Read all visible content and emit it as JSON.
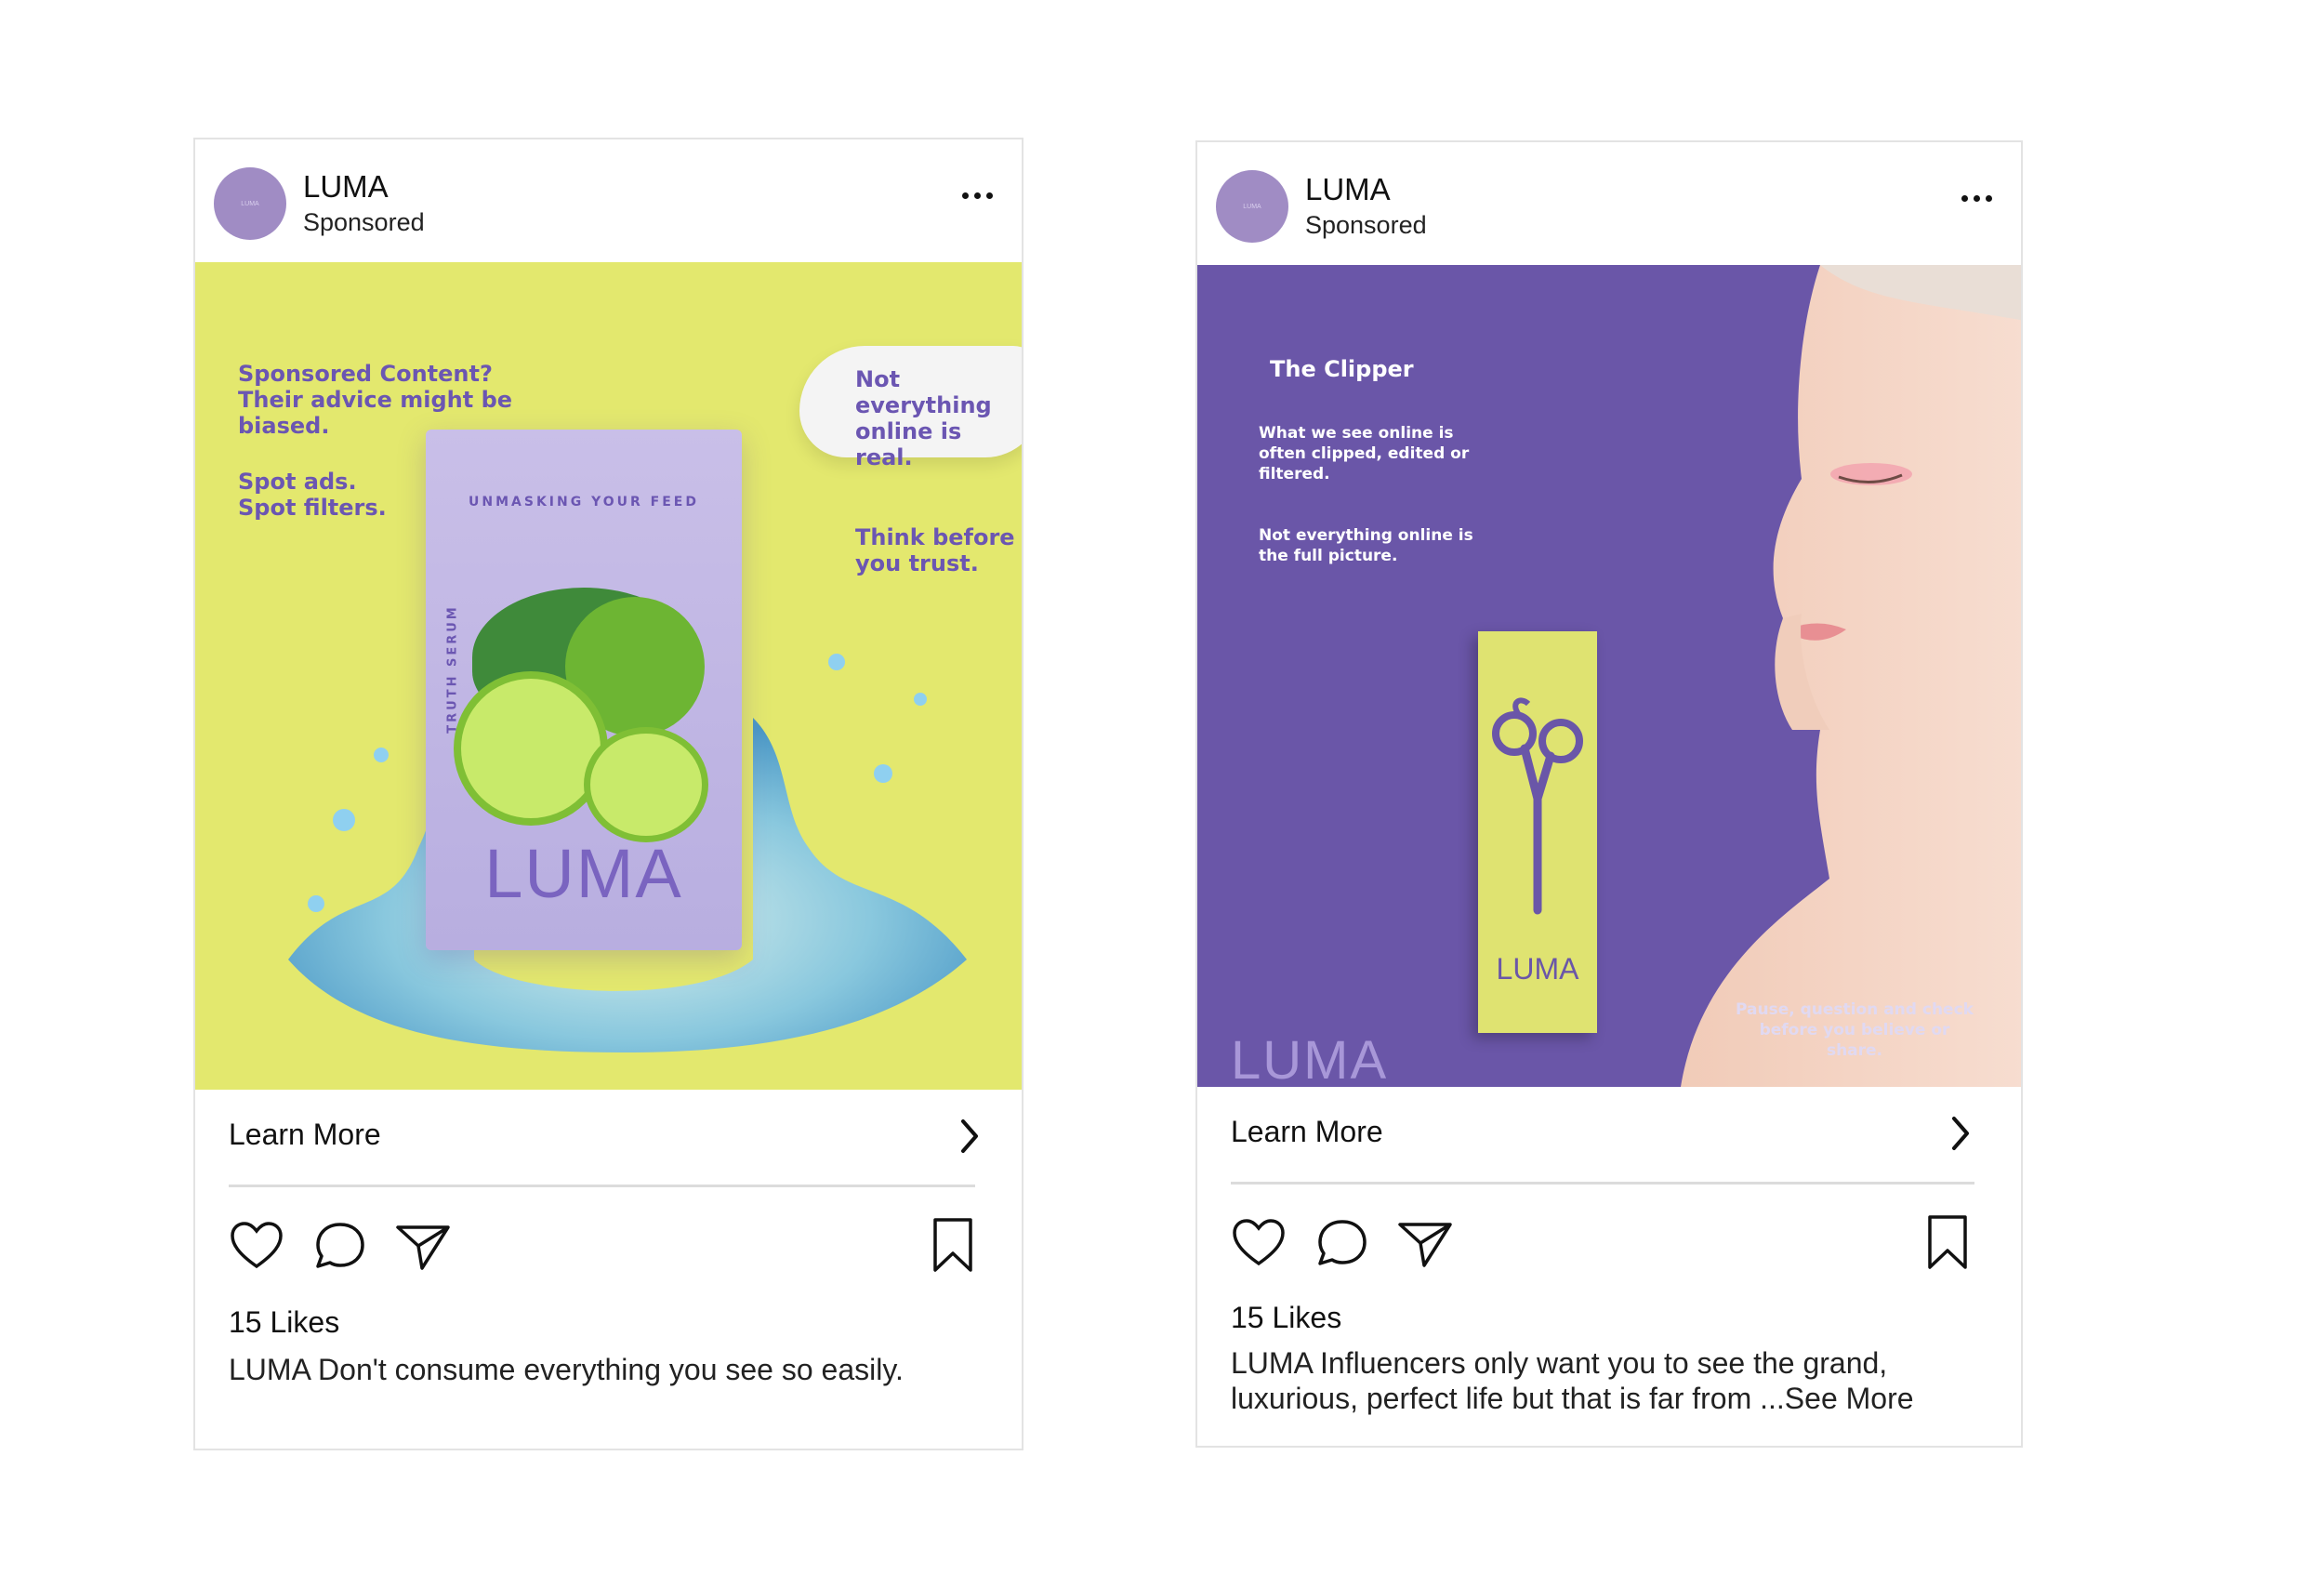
{
  "posts": [
    {
      "account": "LUMA",
      "sponsored": "Sponsored",
      "avatar_text": "LUMA",
      "learn_more": "Learn More",
      "likes": "15 Likes",
      "caption": "LUMA Don't consume everything you see so easily.",
      "art": {
        "left_text_1": "Sponsored Content? Their advice might be biased.",
        "left_text_2": "Spot ads. Spot filters.",
        "bubble_text": "Not everything online is real.",
        "right_text": "Think before you trust.",
        "pouch_tag": "UNMASKING YOUR FEED",
        "pouch_side": "TRUTH SERUM",
        "pouch_logo": "LUMA"
      }
    },
    {
      "account": "LUMA",
      "sponsored": "Sponsored",
      "avatar_text": "LUMA",
      "learn_more": "Learn More",
      "likes": "15 Likes",
      "caption": "LUMA Influencers only want you to see the grand, luxurious, perfect life but that is far from ...See More",
      "art": {
        "heading": "The Clipper",
        "text_1": "What we see online is often clipped, edited or filtered.",
        "text_2": "Not everything online is the full picture.",
        "footer_text": "Pause, question and check before you believe or share.",
        "box_logo": "LUMA",
        "corner_logo": "LUMA"
      }
    }
  ],
  "colors": {
    "lime_bg": "#e3e86e",
    "purple": "#6a56a8",
    "text_purple": "#6b56b2",
    "avatar": "#a08cc4"
  },
  "icons": [
    "heart-icon",
    "comment-icon",
    "share-icon",
    "bookmark-icon",
    "chevron-right-icon",
    "more-icon"
  ]
}
